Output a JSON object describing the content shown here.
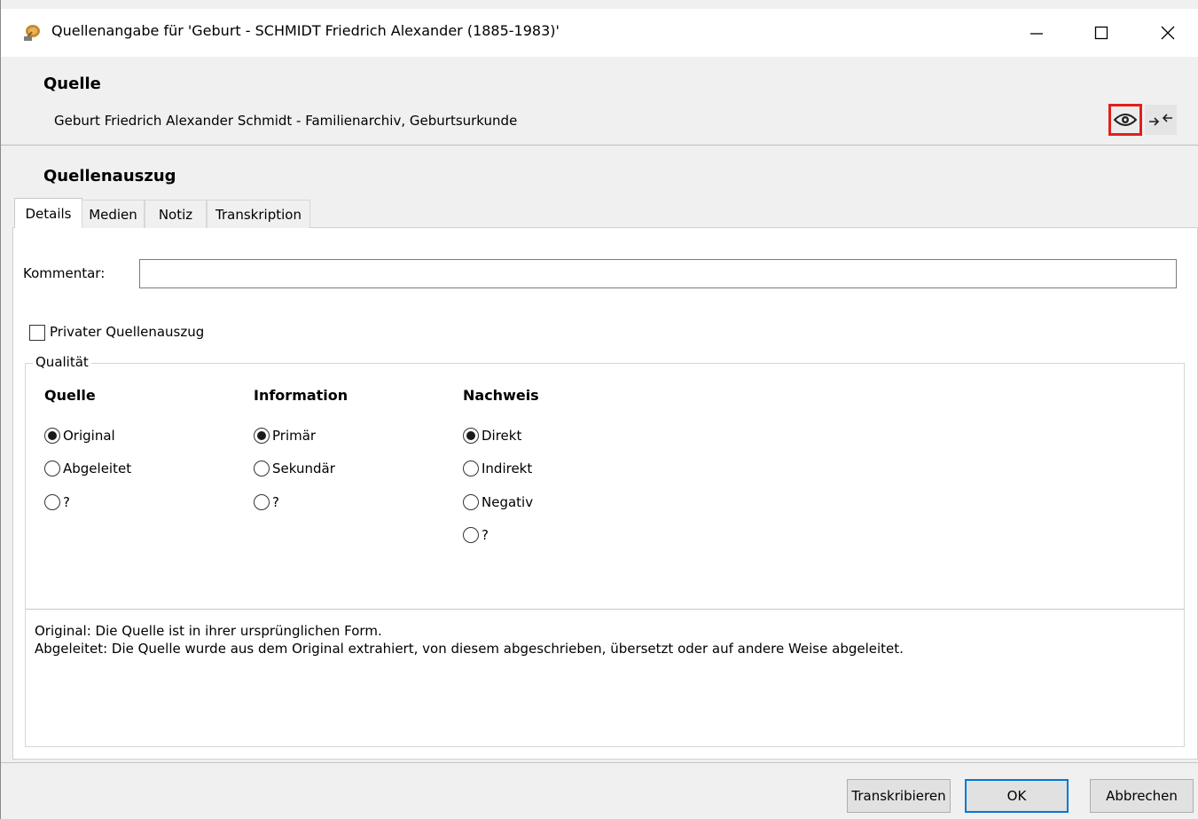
{
  "window": {
    "title": "Quellenangabe für 'Geburt - SCHMIDT Friedrich Alexander (1885-1983)'",
    "minimize_icon": "minimize-icon",
    "maximize_icon": "maximize-icon",
    "close_icon": "close-icon"
  },
  "source": {
    "heading": "Quelle",
    "value": "Geburt Friedrich Alexander Schmidt - Familienarchiv, Geburtsurkunde",
    "view_icon": "eye-icon",
    "link_icon": "arrows-link-icon"
  },
  "excerpt": {
    "heading": "Quellenauszug",
    "tabs": [
      {
        "label": "Details",
        "active": true
      },
      {
        "label": "Medien",
        "active": false
      },
      {
        "label": "Notiz",
        "active": false
      },
      {
        "label": "Transkription",
        "active": false
      }
    ]
  },
  "details": {
    "comment_label": "Kommentar:",
    "comment_value": "",
    "private_label": "Privater Quellenauszug",
    "private_checked": false,
    "quality_legend": "Qualität",
    "columns": [
      {
        "heading": "Quelle",
        "options": [
          {
            "label": "Original",
            "selected": true
          },
          {
            "label": "Abgeleitet",
            "selected": false
          },
          {
            "label": "?",
            "selected": false
          }
        ]
      },
      {
        "heading": "Information",
        "options": [
          {
            "label": "Primär",
            "selected": true
          },
          {
            "label": "Sekundär",
            "selected": false
          },
          {
            "label": "?",
            "selected": false
          }
        ]
      },
      {
        "heading": "Nachweis",
        "options": [
          {
            "label": "Direkt",
            "selected": true
          },
          {
            "label": "Indirekt",
            "selected": false
          },
          {
            "label": "Negativ",
            "selected": false
          },
          {
            "label": "?",
            "selected": false
          }
        ]
      }
    ],
    "description": [
      "Original: Die Quelle ist in ihrer ursprünglichen Form.",
      "Abgeleitet: Die Quelle wurde aus dem Original extrahiert, von diesem abgeschrieben, übersetzt oder auf andere Weise abgeleitet."
    ]
  },
  "buttons": {
    "transcribe": "Transkribieren",
    "ok": "OK",
    "cancel": "Abbrechen"
  },
  "colors": {
    "highlight": "#e0201b",
    "default_button_border": "#0078d7"
  }
}
